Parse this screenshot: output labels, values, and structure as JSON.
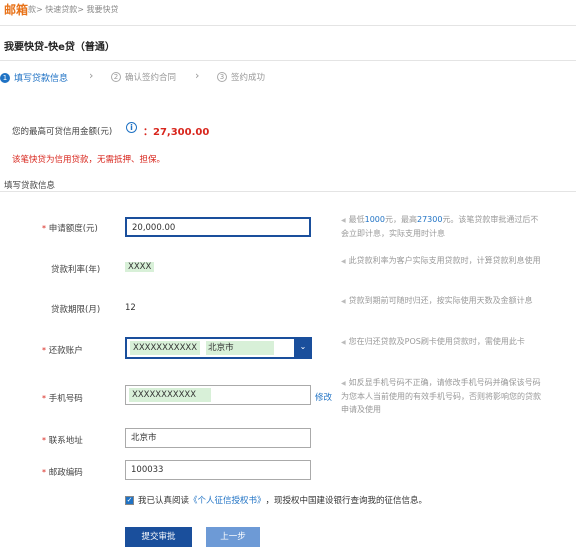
{
  "breadcrumb": {
    "brand": "邮箱",
    "path": "款> 快速贷款> 我要快贷"
  },
  "page": {
    "title": "我要快贷-快e贷（普通）"
  },
  "steps": [
    {
      "num": "1",
      "label": "填写贷款信息"
    },
    {
      "num": "2",
      "label": "确认签约合同"
    },
    {
      "num": "3",
      "label": "签约成功"
    }
  ],
  "limit": {
    "label": "您的最高可贷信用金额(元)",
    "icon": "info-icon",
    "value": "：27,300.00"
  },
  "notice": "该笔快贷为信用贷款，无需抵押、担保。",
  "section_title": "填写贷款信息",
  "form": {
    "amount": {
      "label": "申请额度(元)",
      "value": "20,000.00"
    },
    "rate": {
      "label": "贷款利率(年)",
      "value": "XXXX"
    },
    "term": {
      "label": "贷款期限(月)",
      "value": "12"
    },
    "account": {
      "label": "还款账户",
      "number": "XXXXXXXXXXX",
      "city": "北京市"
    },
    "phone": {
      "label": "手机号码",
      "value": "XXXXXXXXXXX",
      "edit": "修改"
    },
    "address": {
      "label": "联系地址",
      "value": "北京市"
    },
    "zip": {
      "label": "邮政编码",
      "value": "100033"
    }
  },
  "tips": {
    "amount_pre": "最低",
    "amount_min": "1000",
    "amount_mid": "元，最高",
    "amount_max": "27300",
    "amount_post": "元。该笔贷款审批通过后不会立即计息，实际支用时计息",
    "rate": "此贷款利率为客户实际支用贷款时，计算贷款利息使用",
    "term": "贷款到期前可随时归还，按实际使用天数及金额计息",
    "account": "您在归还贷款及POS刷卡使用贷款时，需使用此卡",
    "phone": "如反显手机号码不正确，请修改手机号码并确保该号码为您本人当前使用的有效手机号码，否则将影响您的贷款申请及使用"
  },
  "agreement": {
    "pre": "我已认真阅读",
    "book": "《个人征信授权书》",
    "post": "，现授权中国建设银行查询我的征信信息。"
  },
  "buttons": {
    "submit": "提交审批",
    "back": "上一步"
  },
  "colors": {
    "accent": "#1f72c4",
    "primary_button": "#1a4f9c",
    "secondary_button": "#6d9ad6",
    "warning": "#d8261d",
    "brand": "#e8731a"
  }
}
